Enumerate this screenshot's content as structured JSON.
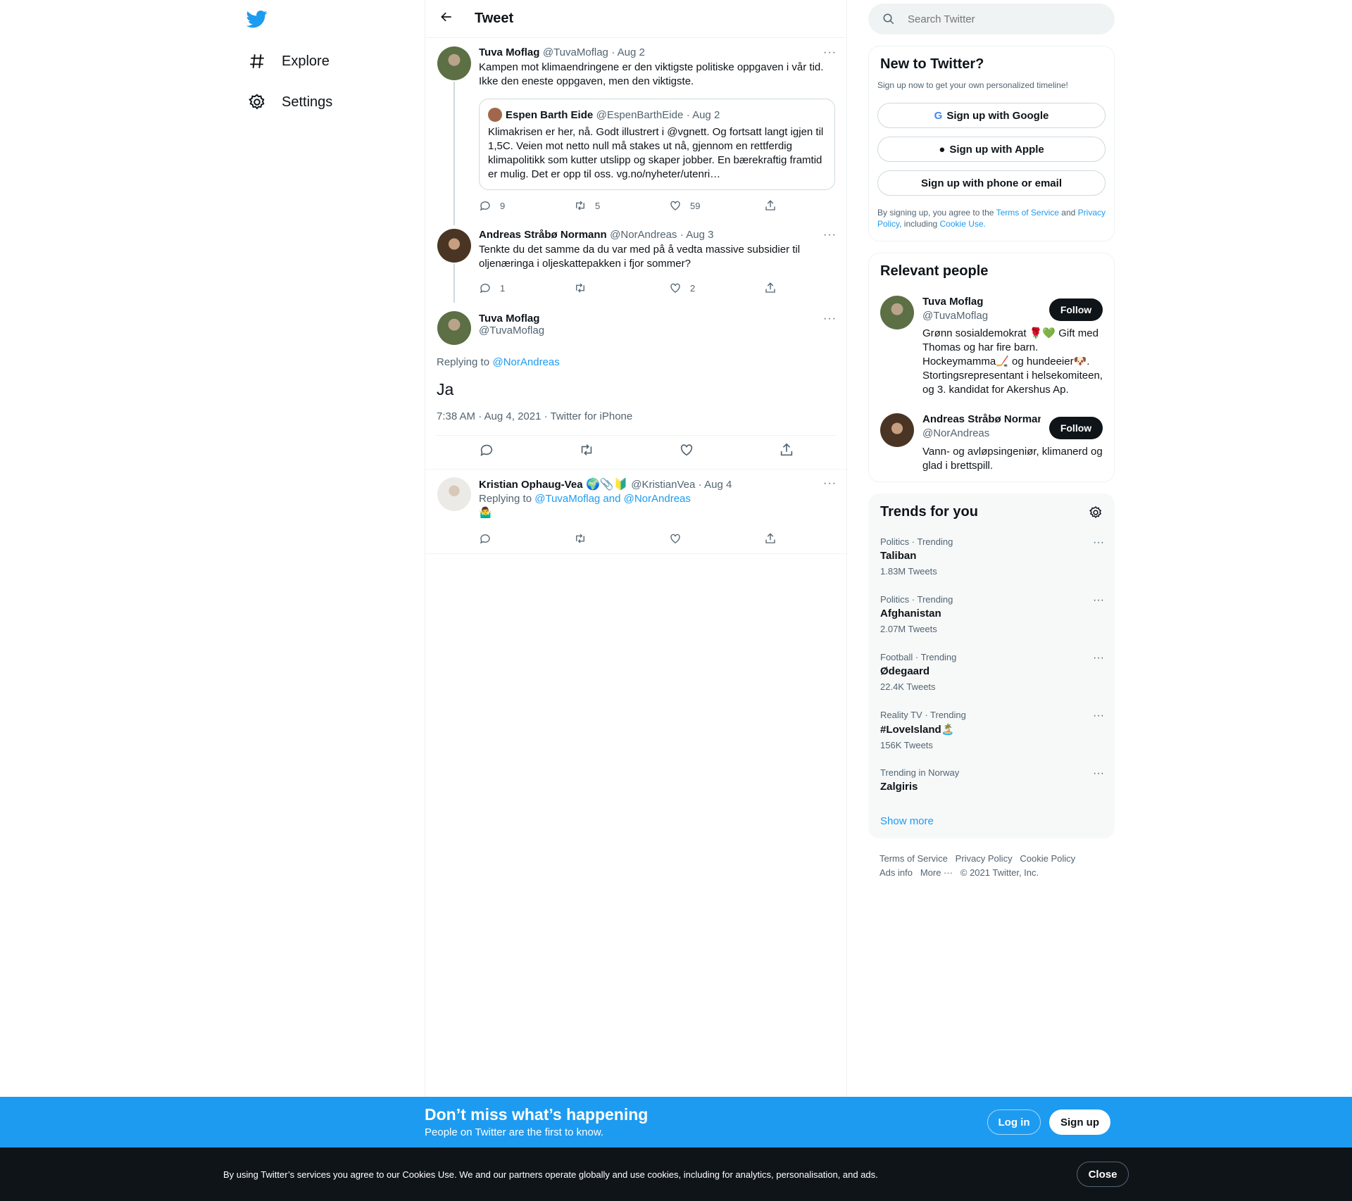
{
  "nav": {
    "explore": "Explore",
    "settings": "Settings"
  },
  "header": {
    "title": "Tweet"
  },
  "tweets": {
    "t1": {
      "name": "Tuva Moflag",
      "handle": "@TuvaMoflag",
      "date": "· Aug 2",
      "text": "Kampen mot klimaendringene er den viktigste politiske oppgaven i vår tid. Ikke den eneste oppgaven, men den viktigste.",
      "quote": {
        "name": "Espen Barth Eide",
        "handle": "@EspenBarthEide",
        "date": "· Aug 2",
        "text": "Klimakrisen er her, nå. Godt illustrert i @vgnett. Og fortsatt langt igjen til 1,5C. Veien mot netto null må stakes ut nå, gjennom en rettferdig klimapolitikk som kutter utslipp og skaper jobber. En bærekraftig framtid er mulig. Det er opp til oss. vg.no/nyheter/utenri…"
      },
      "replies": "9",
      "retweets": "5",
      "likes": "59"
    },
    "t2": {
      "name": "Andreas Stråbø Normann",
      "handle": "@NorAndreas",
      "date": "· Aug 3",
      "text": "Tenkte du det samme da du var med på å vedta massive subsidier til oljenæringa i oljeskattepakken i fjor sommer?",
      "replies": "1",
      "retweets": "",
      "likes": "2"
    },
    "main": {
      "name": "Tuva Moflag",
      "handle": "@TuvaMoflag",
      "replying_prefix": "Replying to",
      "replying_to": "@NorAndreas",
      "text": "Ja",
      "meta": "7:38 AM · Aug 4, 2021 · Twitter for iPhone"
    },
    "t4": {
      "name": "Kristian Ophaug-Vea",
      "emoji": "🌍📎🔰",
      "handle": "@KristianVea",
      "date": "· Aug 4",
      "replying_prefix": "Replying to",
      "replying_to": "@TuvaMoflag and @NorAndreas",
      "text": "🤷‍♂️"
    }
  },
  "search": {
    "placeholder": "Search Twitter"
  },
  "signup": {
    "title": "New to Twitter?",
    "subtitle": "Sign up now to get your own personalized timeline!",
    "google": "Sign up with Google",
    "apple": "Sign up with Apple",
    "phone": "Sign up with phone or email",
    "legal_1": "By signing up, you agree to the",
    "tos": "Terms of Service",
    "and": "and",
    "privacy": "Privacy Policy",
    "including": ", including",
    "cookie": "Cookie Use."
  },
  "relevant": {
    "title": "Relevant people",
    "p1": {
      "name": "Tuva Moflag",
      "handle": "@TuvaMoflag",
      "bio": "Grønn sosialdemokrat 🌹💚 Gift med Thomas og har fire barn. Hockeymamma🏒 og hundeeier🐶. Stortingsrepresentant i helsekomiteen, og 3. kandidat for Akershus Ap.",
      "follow": "Follow"
    },
    "p2": {
      "name": "Andreas Stråbø Normann",
      "handle": "@NorAndreas",
      "bio": "Vann- og avløpsingeniør, klimanerd og glad i brettspill.",
      "follow": "Follow"
    }
  },
  "trends": {
    "title": "Trends for you",
    "items": [
      {
        "cat": "Politics · Trending",
        "topic": "Taliban",
        "count": "1.83M Tweets"
      },
      {
        "cat": "Politics · Trending",
        "topic": "Afghanistan",
        "count": "2.07M Tweets"
      },
      {
        "cat": "Football · Trending",
        "topic": "Ødegaard",
        "count": "22.4K Tweets"
      },
      {
        "cat": "Reality TV · Trending",
        "topic": "#LoveIsland🏝️",
        "count": "156K Tweets"
      },
      {
        "cat": "Trending in Norway",
        "topic": "Zalgiris",
        "count": ""
      }
    ],
    "show_more": "Show more"
  },
  "footer": {
    "tos": "Terms of Service",
    "privacy": "Privacy Policy",
    "cookie": "Cookie Policy",
    "ads": "Ads info",
    "more": "More ···",
    "copyright": "© 2021 Twitter, Inc."
  },
  "banner": {
    "title": "Don’t miss what’s happening",
    "subtitle": "People on Twitter are the first to know.",
    "login": "Log in",
    "signup": "Sign up"
  },
  "cookie_bar": {
    "text": "By using Twitter’s services you agree to our Cookies Use. We and our partners operate globally and use cookies, including for analytics, personalisation, and ads.",
    "close": "Close"
  },
  "colors": {
    "accent": "#1d9bf0",
    "text": "#0f1419",
    "muted": "#536471",
    "dark": "#0f1419"
  }
}
